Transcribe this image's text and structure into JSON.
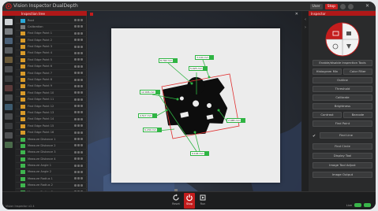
{
  "window": {
    "title": "Vision Inspector DualDepth",
    "close_glyph": "✕",
    "top_right": {
      "login": "User",
      "mode": "Stop"
    }
  },
  "left_panel": {
    "header": "Inspection tree",
    "items": [
      {
        "label": "Root",
        "icon": "monitor-icon",
        "color": "#2aa8d8"
      },
      {
        "label": "Calibration",
        "icon": "grid-icon",
        "color": "#7a7a7a"
      },
      {
        "label": "Find Edge Point 1",
        "icon": "edge-tool-icon",
        "color": "#d89a2a"
      },
      {
        "label": "Find Edge Point 2",
        "icon": "edge-tool-icon",
        "color": "#d89a2a"
      },
      {
        "label": "Find Edge Point 3",
        "icon": "edge-tool-icon",
        "color": "#d89a2a"
      },
      {
        "label": "Find Edge Point 4",
        "icon": "edge-tool-icon",
        "color": "#d89a2a"
      },
      {
        "label": "Find Edge Point 5",
        "icon": "edge-tool-icon",
        "color": "#d89a2a"
      },
      {
        "label": "Find Edge Point 6",
        "icon": "edge-tool-icon",
        "color": "#d89a2a"
      },
      {
        "label": "Find Edge Point 7",
        "icon": "edge-tool-icon",
        "color": "#d89a2a"
      },
      {
        "label": "Find Edge Point 8",
        "icon": "edge-tool-icon",
        "color": "#d89a2a"
      },
      {
        "label": "Find Edge Point 9",
        "icon": "edge-tool-icon",
        "color": "#d89a2a"
      },
      {
        "label": "Find Edge Point 10",
        "icon": "edge-tool-icon",
        "color": "#d89a2a"
      },
      {
        "label": "Find Edge Point 11",
        "icon": "edge-tool-icon",
        "color": "#d89a2a"
      },
      {
        "label": "Find Edge Point 12",
        "icon": "edge-tool-icon",
        "color": "#d89a2a"
      },
      {
        "label": "Find Edge Point 13",
        "icon": "edge-tool-icon",
        "color": "#d89a2a"
      },
      {
        "label": "Find Edge Point 14",
        "icon": "edge-tool-icon",
        "color": "#d89a2a"
      },
      {
        "label": "Find Edge Point 15",
        "icon": "edge-tool-icon",
        "color": "#d89a2a"
      },
      {
        "label": "Find Edge Point 16",
        "icon": "edge-tool-icon",
        "color": "#d89a2a"
      },
      {
        "label": "Measure Distance 1",
        "icon": "check-icon",
        "color": "#3fb54f"
      },
      {
        "label": "Measure Distance 2",
        "icon": "check-icon",
        "color": "#3fb54f"
      },
      {
        "label": "Measure Distance 3",
        "icon": "check-icon",
        "color": "#3fb54f"
      },
      {
        "label": "Measure Distance 4",
        "icon": "check-icon",
        "color": "#3fb54f"
      },
      {
        "label": "Measure Angle 1",
        "icon": "check-icon",
        "color": "#3fb54f"
      },
      {
        "label": "Measure Angle 2",
        "icon": "check-icon",
        "color": "#3fb54f"
      },
      {
        "label": "Measure Radius 1",
        "icon": "check-icon",
        "color": "#3fb54f"
      },
      {
        "label": "Measure Radius 2",
        "icon": "check-icon",
        "color": "#3fb54f"
      },
      {
        "label": "Measure Radius 3",
        "icon": "check-icon",
        "color": "#3fb54f"
      }
    ]
  },
  "viewport": {
    "close_glyph": "✕",
    "measurements": [
      {
        "label": "5.025 mm"
      },
      {
        "label": "3.140 mm"
      },
      {
        "label": "8.792 mm"
      },
      {
        "label": "12.006 mm"
      },
      {
        "label": "4.517 mm"
      },
      {
        "label": "6.230 mm"
      },
      {
        "label": "2.985 mm"
      },
      {
        "label": "9.104 mm"
      }
    ]
  },
  "right_panel": {
    "header": "Inspector",
    "buttons": [
      "Enable/disable Inspection Tools",
      "Histogram Min",
      "Color Filter",
      "Outline",
      "Threshold",
      "Calibrate",
      "Brightness",
      "Contrast",
      "Barcode",
      "Find Point",
      "Find Line",
      "Find Circle",
      "Display Tool",
      "Image Tool Adjust",
      "Image Output"
    ],
    "checks": [
      "✔"
    ]
  },
  "bottom_bar": {
    "buttons": [
      {
        "label": "Reset",
        "icon": "refresh-icon"
      },
      {
        "label": "Stop",
        "icon": "power-icon"
      },
      {
        "label": "Run",
        "icon": "run-icon"
      }
    ],
    "status_left": "Vision Inspector v2.4",
    "status_right": "Live"
  },
  "colors": {
    "accent": "#c41d1d",
    "ok": "#39b54a",
    "measure": "#3fb54f"
  }
}
